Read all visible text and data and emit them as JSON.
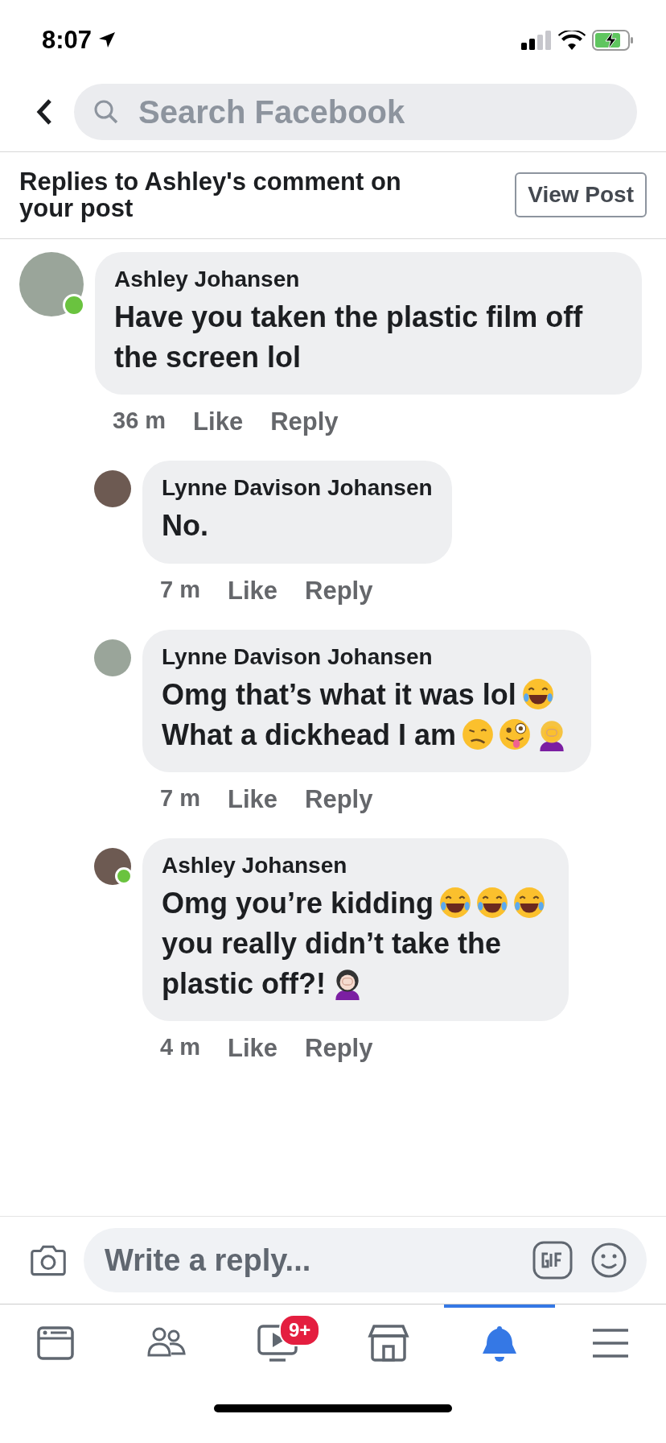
{
  "status_bar": {
    "time": "8:07"
  },
  "search": {
    "placeholder": "Search Facebook"
  },
  "header": {
    "title": "Replies to Ashley's comment on your **post**",
    "button": "View Post"
  },
  "comments": [
    {
      "author": "Ashley Johansen",
      "online": true,
      "reply": false,
      "body": [
        [
          {
            "kind": "text",
            "text": "Have you taken the plastic film off the screen lol"
          }
        ]
      ],
      "time": "36 m",
      "like": "Like",
      "reply_label": "Reply"
    },
    {
      "author": "Lynne Davison Johansen",
      "online": false,
      "reply": true,
      "body": [
        [
          {
            "kind": "text",
            "text": "No."
          }
        ]
      ],
      "time": "7 m",
      "like": "Like",
      "reply_label": "Reply"
    },
    {
      "author": "Lynne Davison Johansen",
      "online": false,
      "reply": true,
      "body": [
        [
          {
            "kind": "text",
            "text": "Omg that’s what it was lol"
          },
          {
            "kind": "laugh"
          }
        ],
        [
          {
            "kind": "text",
            "text": "What a dickhead I am"
          },
          {
            "kind": "woozy"
          },
          {
            "kind": "zany"
          },
          {
            "kind": "facepalm"
          }
        ]
      ],
      "time": "7 m",
      "like": "Like",
      "reply_label": "Reply"
    },
    {
      "author": "Ashley Johansen",
      "online": true,
      "reply": true,
      "body": [
        [
          {
            "kind": "text",
            "text": "Omg you’re kidding"
          },
          {
            "kind": "laugh"
          },
          {
            "kind": "laugh"
          },
          {
            "kind": "laugh"
          }
        ],
        [
          {
            "kind": "text",
            "text": "you really didn’t take the"
          }
        ],
        [
          {
            "kind": "text",
            "text": "plastic off?!"
          },
          {
            "kind": "facepalm_dark"
          }
        ]
      ],
      "time": "4 m",
      "like": "Like",
      "reply_label": "Reply"
    }
  ],
  "composer": {
    "placeholder": "Write a reply..."
  },
  "nav": [
    {
      "kind": "news",
      "selected": false
    },
    {
      "kind": "friends",
      "selected": false
    },
    {
      "kind": "watch",
      "selected": false,
      "badge": "9+"
    },
    {
      "kind": "market",
      "selected": false
    },
    {
      "kind": "bell",
      "selected": true
    },
    {
      "kind": "menu",
      "selected": false
    }
  ]
}
